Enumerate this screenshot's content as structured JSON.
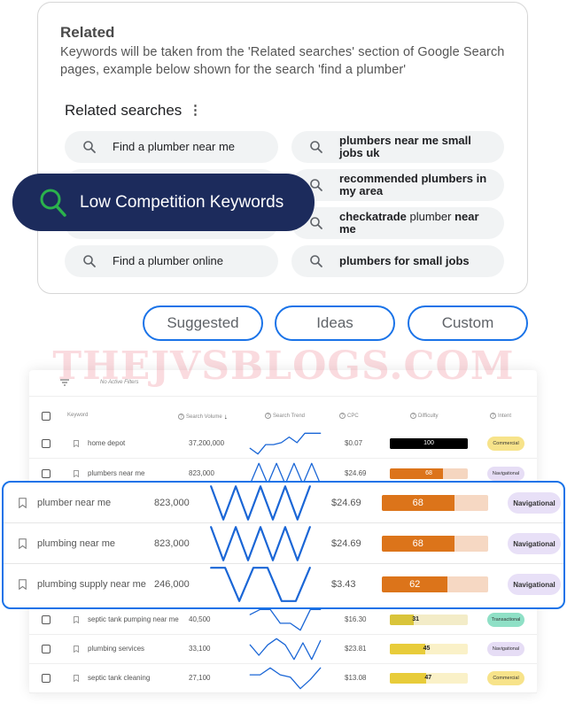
{
  "related": {
    "title": "Related",
    "description": "Keywords will be taken from the 'Related searches' section of Google Search pages, example below shown for the search 'find a plumber'",
    "section_heading": "Related searches",
    "menu_icon": "more-vert-icon",
    "searches_left": [
      {
        "text": "Find a plumber near me"
      },
      {
        "text": ""
      },
      {
        "text": ""
      },
      {
        "text": "Find a plumber online"
      }
    ],
    "searches_right": [
      {
        "parts": [
          {
            "t": "plumbers near me small jobs uk",
            "bold": true
          }
        ]
      },
      {
        "parts": [
          {
            "t": "recommended plumbers in my area",
            "bold": true
          }
        ]
      },
      {
        "parts": [
          {
            "t": "checkatrade",
            "bold": true
          },
          {
            "t": " plumber ",
            "bold": false
          },
          {
            "t": "near me",
            "bold": true
          }
        ]
      },
      {
        "parts": [
          {
            "t": "plumbers for small jobs",
            "bold": true
          }
        ]
      }
    ]
  },
  "badge": {
    "label": "Low Competition Keywords",
    "icon": "search-icon",
    "color": "#1c2b5c",
    "icon_color": "#2bb24c"
  },
  "tabs": [
    {
      "label": "Suggested"
    },
    {
      "label": "Ideas"
    },
    {
      "label": "Custom"
    }
  ],
  "watermark": "THEJVSBLOGS.COM",
  "table": {
    "filter_text": "No Active Filters",
    "headers": {
      "keyword": "Keyword",
      "volume": "Search Volume",
      "trend": "Search Trend",
      "cpc": "CPC",
      "difficulty": "Difficulty",
      "intent": "Intent"
    },
    "rows_top": [
      {
        "keyword": "home depot",
        "volume": "37,200,000",
        "trend": [
          6,
          3,
          8,
          8,
          9,
          12,
          9,
          14,
          14,
          14
        ],
        "cpc": "$0.07",
        "difficulty": 100,
        "diff_color": "#000000",
        "diff_bg": "#000000",
        "diff_text": "#ffffff",
        "intent": "Commercial",
        "intent_color": "#f7e38a"
      },
      {
        "keyword": "plumbers near me",
        "volume": "823,000",
        "trend": [
          0,
          14,
          0,
          14,
          0,
          14,
          0,
          14,
          0
        ],
        "cpc": "$24.69",
        "difficulty": 68,
        "diff_color": "#dc741a",
        "diff_bg": "#f5d6c0",
        "diff_text": "#ffffff",
        "intent": "Navigational",
        "intent_color": "#e6ddf5"
      }
    ],
    "rows_highlight": [
      {
        "keyword": "plumber near me",
        "volume": "823,000",
        "trend": [
          10,
          0,
          10,
          0,
          10,
          0,
          10,
          0,
          10
        ],
        "cpc": "$24.69",
        "difficulty": 68,
        "diff_color": "#dc741a",
        "diff_bg": "#f6d8c3",
        "intent": "Navigational",
        "intent_color": "#e8e0f7"
      },
      {
        "keyword": "plumbing near me",
        "volume": "823,000",
        "trend": [
          10,
          0,
          10,
          0,
          10,
          0,
          10,
          0,
          10
        ],
        "cpc": "$24.69",
        "difficulty": 68,
        "diff_color": "#dc741a",
        "diff_bg": "#f6d8c3",
        "intent": "Navigational",
        "intent_color": "#e8e0f7"
      },
      {
        "keyword": "plumbing supply near me",
        "volume": "246,000",
        "trend": [
          10,
          10,
          0,
          10,
          10,
          0,
          0,
          10
        ],
        "cpc": "$3.43",
        "difficulty": 62,
        "diff_color": "#dc741a",
        "diff_bg": "#f6d8c3",
        "intent": "Navigational",
        "intent_color": "#e8e0f7"
      }
    ],
    "rows_bottom": [
      {
        "keyword": "septic tank pumping near me",
        "volume": "40,500",
        "trend": [
          9,
          12,
          12,
          4,
          4,
          0,
          12,
          12
        ],
        "cpc": "$16.30",
        "difficulty": 31,
        "diff_color": "#d9c43a",
        "diff_bg": "#f3ecc8",
        "intent": "Transactional",
        "intent_color": "#8fe0c6"
      },
      {
        "keyword": "plumbing services",
        "volume": "33,100",
        "trend": [
          10,
          5,
          10,
          13,
          10,
          3,
          11,
          3,
          12
        ],
        "cpc": "$23.81",
        "difficulty": 45,
        "diff_color": "#e8cc3a",
        "diff_bg": "#faf1c8",
        "intent": "Navigational",
        "intent_color": "#e6ddf5"
      },
      {
        "keyword": "septic tank cleaning",
        "volume": "27,100",
        "trend": [
          9,
          9,
          12,
          9,
          8,
          3,
          7,
          12
        ],
        "cpc": "$13.08",
        "difficulty": 47,
        "diff_color": "#e8cc3a",
        "diff_bg": "#faf1c8",
        "intent": "Commercial",
        "intent_color": "#f7e38a"
      }
    ]
  },
  "colors": {
    "accent": "#1a73e8",
    "trend_line": "#1a66d6"
  }
}
